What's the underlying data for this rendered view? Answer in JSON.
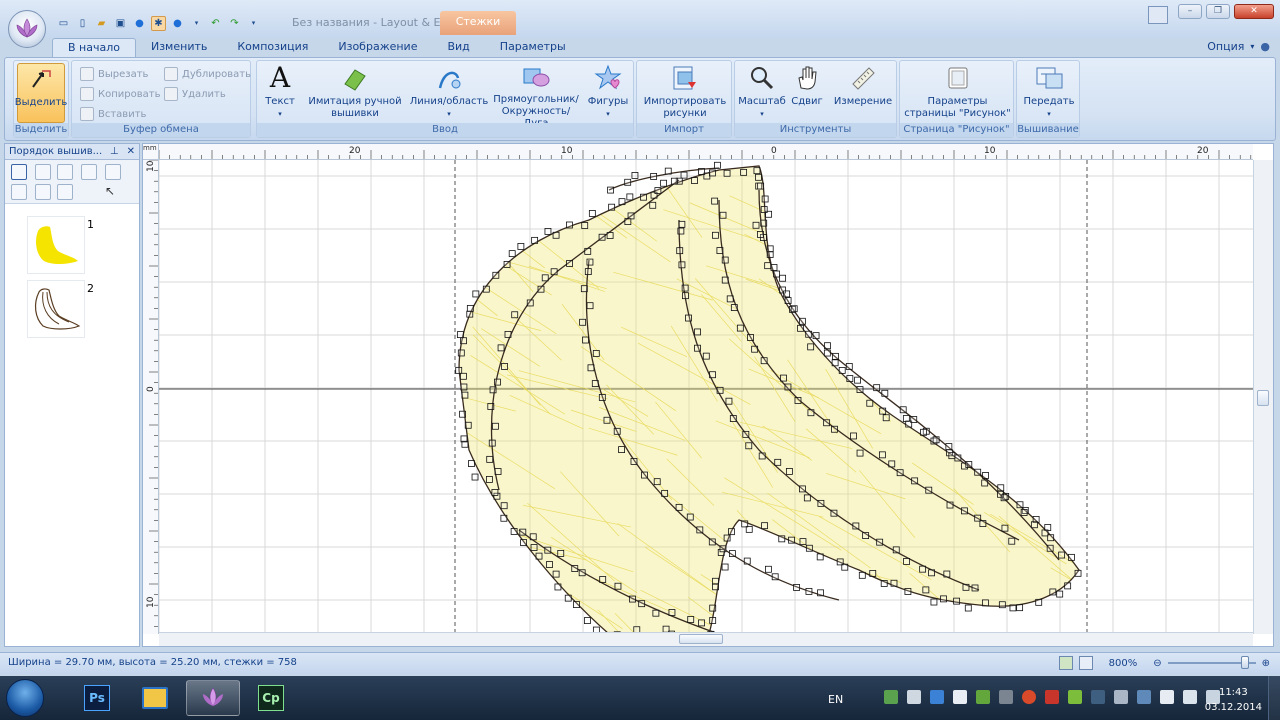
{
  "window": {
    "title": "Без названия - Layout & E...",
    "context_tab": "Стежки"
  },
  "tabs": [
    "В начало",
    "Изменить",
    "Композиция",
    "Изображение",
    "Вид",
    "Параметры"
  ],
  "options_label": "Опция",
  "ribbon": {
    "select": {
      "label": "Выделить",
      "group": "Выделить"
    },
    "clipboard": {
      "cut": "Вырезать",
      "copy": "Копировать",
      "paste": "Вставить",
      "duplicate": "Дублировать",
      "delete": "Удалить",
      "group": "Буфер обмена"
    },
    "input": {
      "text": "Текст",
      "handstitch_1": "Имитация ручной",
      "handstitch_2": "вышивки",
      "line_1": "Линия/область",
      "shape_1": "Прямоугольник/",
      "shape_2": "Окружность/Дуга",
      "figures": "Фигуры",
      "group": "Ввод"
    },
    "import": {
      "label_1": "Импортировать",
      "label_2": "рисунки",
      "group": "Импорт"
    },
    "tools": {
      "zoom": "Масштаб",
      "pan": "Сдвиг",
      "measure": "Измерение",
      "group": "Инструменты"
    },
    "page": {
      "label_1": "Параметры",
      "label_2": "страницы \"Рисунок\"",
      "group": "Страница \"Рисунок\""
    },
    "embroidery": {
      "transfer": "Передать",
      "group": "Вышивание"
    }
  },
  "left_panel": {
    "title": "Порядок вышив...",
    "items": [
      {
        "number": "1"
      },
      {
        "number": "2"
      }
    ]
  },
  "rulers": {
    "unit": "mm",
    "h_labels": [
      "20",
      "10",
      "0",
      "10",
      "20"
    ],
    "v_labels": [
      "10",
      "0",
      "10"
    ]
  },
  "status": {
    "text": "Ширина = 29.70 мм, высота = 25.20 мм, стежки = 758",
    "zoom": "800%",
    "zoom_fraction": 0.92
  },
  "taskbar": {
    "apps": [
      "Ps",
      "",
      "",
      "Cp"
    ],
    "lang": "EN",
    "time": "11:43",
    "date": "03.12.2014"
  },
  "colors": {
    "stitch_yellow": "#efe46a",
    "outline": "#3a2b1f",
    "ribbon_bg": "#d4e2f3"
  }
}
